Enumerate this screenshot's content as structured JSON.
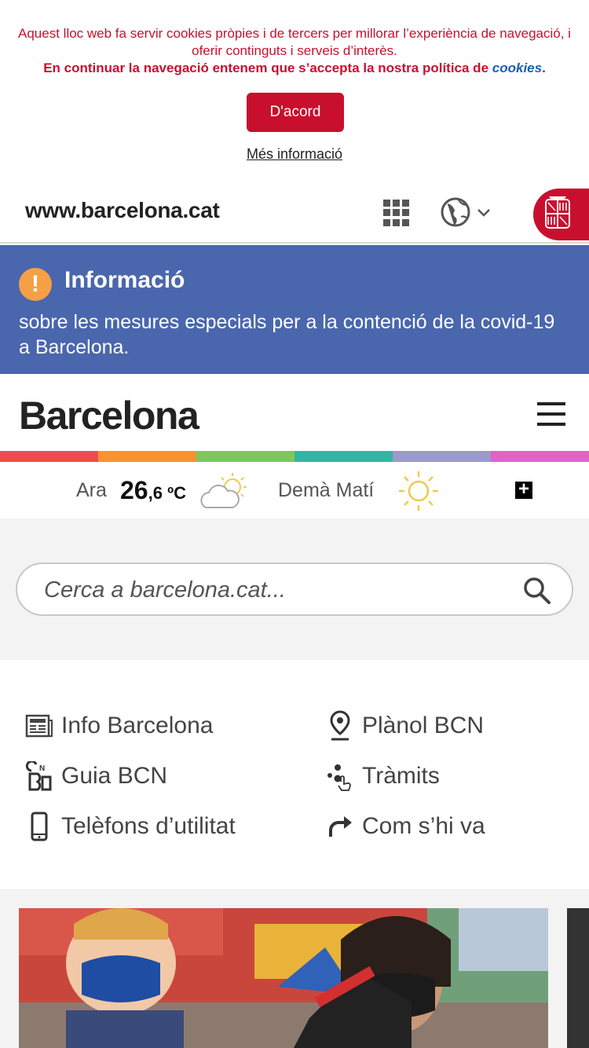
{
  "cookie": {
    "text": "Aquest lloc web fa servir cookies pròpies i de tercers per millorar l’experiència de navegació, i oferir continguts i serveis d’interès.",
    "strong_text": "En continuar la navegació entenem que s’accepta la nostra política de",
    "link": "cookies",
    "period": ".",
    "accept_label": "D'acord",
    "more_info": "Més informació"
  },
  "topbar": {
    "site": "www.barcelona.cat"
  },
  "info": {
    "icon": "!",
    "title": "Informació",
    "body": "sobre les mesures especials per a la contenció de la covid-19 a Barcelona."
  },
  "brand": {
    "title": "Barcelona"
  },
  "stripes": [
    "#f04b4b",
    "#fb9230",
    "#7dc85b",
    "#33b5a5",
    "#9a9acb",
    "#e063c7"
  ],
  "weather": {
    "now_label": "Ara",
    "temp_int": "26",
    "temp_dec": ",6",
    "unit": " ºC",
    "tomorrow_label": "Demà Matí",
    "plus": "+"
  },
  "search": {
    "placeholder": "Cerca a barcelona.cat..."
  },
  "quick_links": [
    {
      "label": "Info Barcelona",
      "icon": "newspaper-icon"
    },
    {
      "label": "Plànol BCN",
      "icon": "map-pin-icon"
    },
    {
      "label": "Guia BCN",
      "icon": "guide-icon"
    },
    {
      "label": "Tràmits",
      "icon": "procedures-icon"
    },
    {
      "label": "Telèfons d’utilitat",
      "icon": "phone-icon"
    },
    {
      "label": "Com s’hi va",
      "icon": "directions-icon"
    }
  ],
  "colors": {
    "accent_red": "#c8102e",
    "info_blue": "#4a66ad",
    "info_icon": "#f6a046"
  }
}
